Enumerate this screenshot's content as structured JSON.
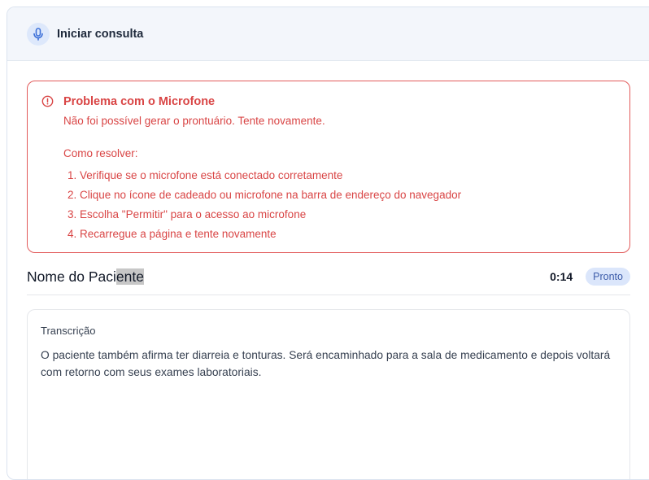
{
  "header": {
    "title": "Iniciar consulta",
    "icon": "microphone-icon"
  },
  "alert": {
    "icon": "alert-circle-icon",
    "title": "Problema com o Microfone",
    "message": "Não foi possível gerar o prontuário. Tente novamente.",
    "steps_title": "Como resolver:",
    "steps": [
      "Verifique se o microfone está conectado corretamente",
      "Clique no ícone de cadeado ou microfone na barra de endereço do navegador",
      "Escolha \"Permitir\" para o acesso ao microfone",
      "Recarregue a página e tente novamente"
    ],
    "color": "#d94545"
  },
  "patient": {
    "name_unselected": "Nome do Paci",
    "name_selected": "ente",
    "timer": "0:14",
    "status": "Pronto"
  },
  "transcription": {
    "label": "Transcrição",
    "text": "O paciente também afirma ter diarreia e tonturas. Será encaminhado para a sala de medicamento e depois voltará com retorno com seus exames laboratoriais."
  },
  "colors": {
    "accent": "#3b6fd8",
    "badge_bg": "#dbe6fb",
    "header_bg": "#f3f6fb"
  }
}
